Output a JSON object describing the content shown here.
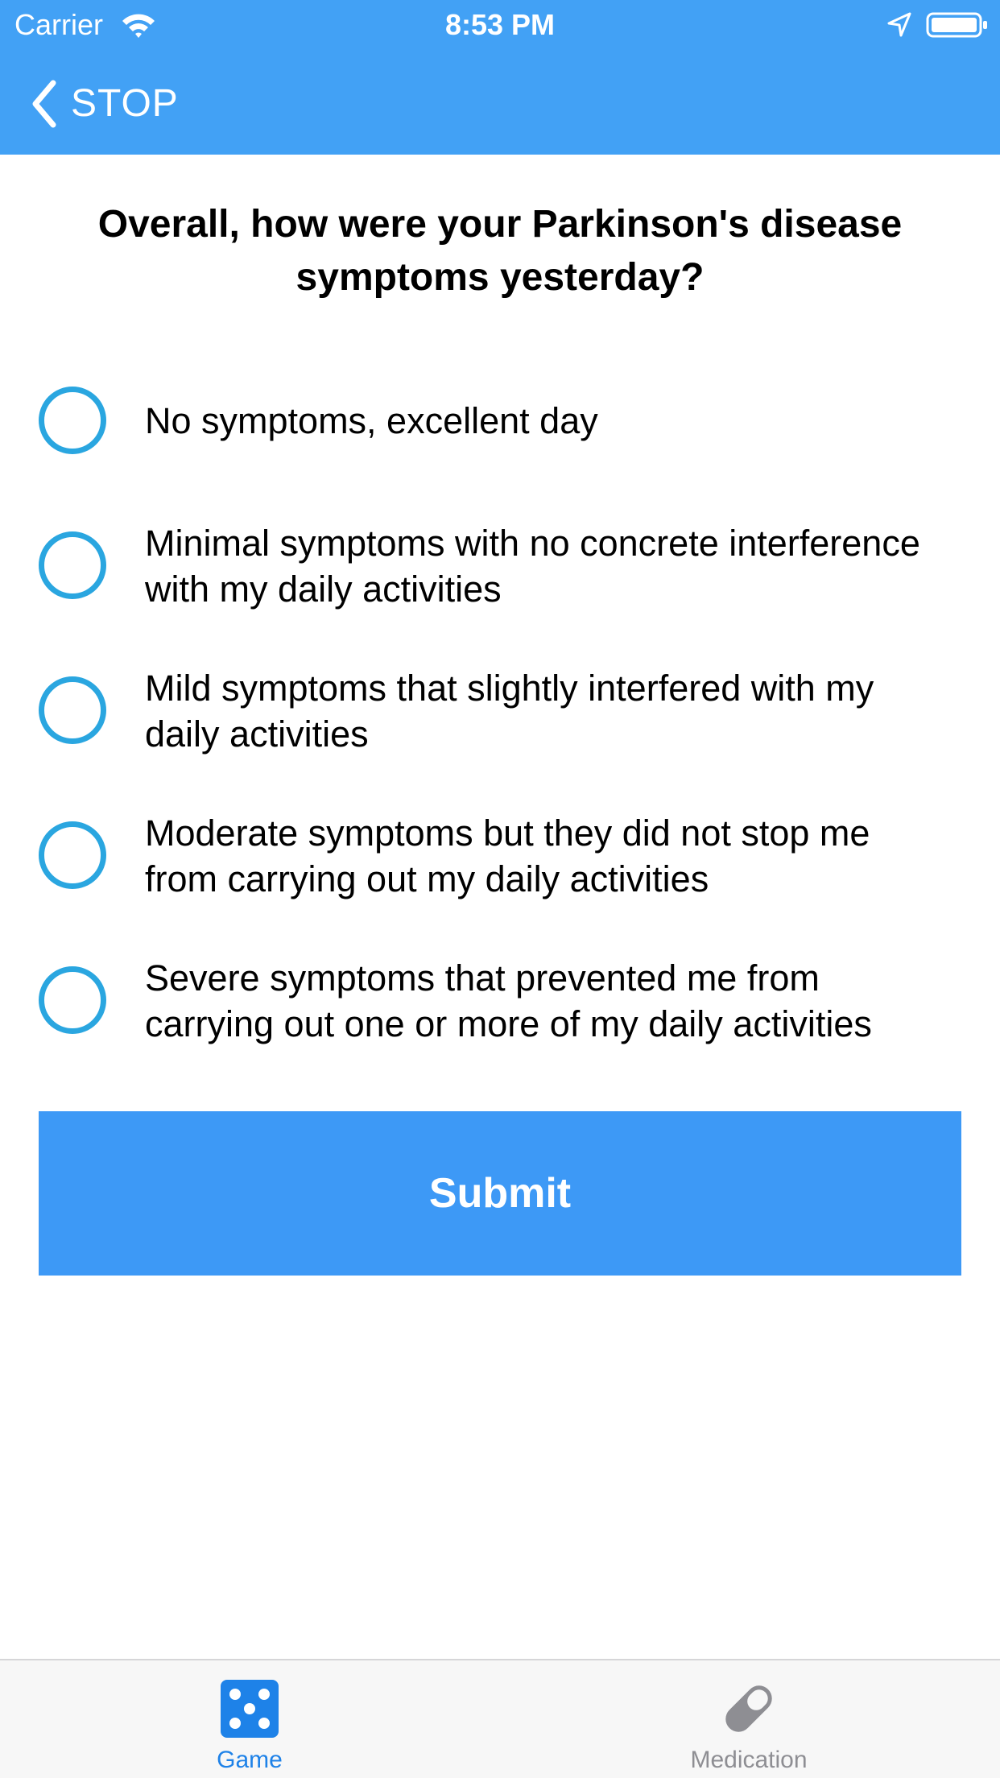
{
  "status_bar": {
    "carrier": "Carrier",
    "time": "8:53 PM",
    "icons": [
      "wifi-icon",
      "location-arrow-icon",
      "battery-icon"
    ]
  },
  "nav": {
    "back_label": "STOP",
    "color": "#42A1F5"
  },
  "question": "Overall, how were your Parkinson's disease symptoms yesterday?",
  "options": [
    {
      "label": "No symptoms, excellent day",
      "selected": false
    },
    {
      "label": "Minimal symptoms with no concrete interference\nwith my daily activities",
      "selected": false
    },
    {
      "label": "Mild symptoms that slightly interfered with my\ndaily activities",
      "selected": false
    },
    {
      "label": "Moderate symptoms but they did not stop me\nfrom carrying out my daily activities",
      "selected": false
    },
    {
      "label": "Severe symptoms that prevented me from\ncarrying out one or more of my daily activities",
      "selected": false
    }
  ],
  "submit_label": "Submit",
  "tabs": [
    {
      "label": "Game",
      "icon": "dice-icon",
      "active": true
    },
    {
      "label": "Medication",
      "icon": "pill-icon",
      "active": false
    }
  ],
  "colors": {
    "accent": "#42A1F5",
    "radio": "#2AA6E0",
    "button": "#3D99F6",
    "tab_active": "#1E82E8",
    "tab_inactive": "#8E8E93"
  }
}
